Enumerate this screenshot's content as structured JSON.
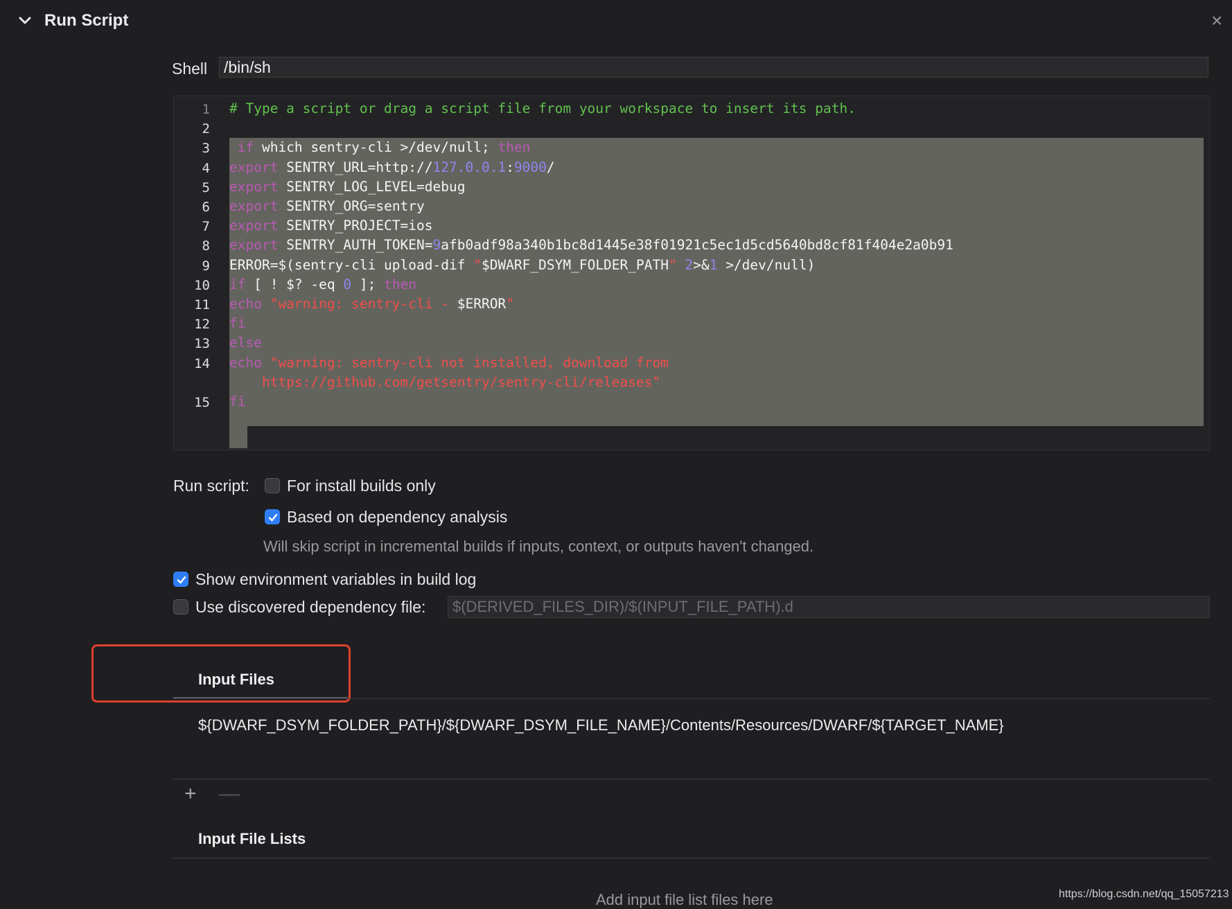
{
  "header": {
    "title": "Run Script",
    "close_glyph": "×",
    "chevron_icon": "chevron-down-icon"
  },
  "shell": {
    "label": "Shell",
    "value": "/bin/sh"
  },
  "editor": {
    "line_numbers": [
      "1",
      "2",
      "3",
      "4",
      "5",
      "6",
      "7",
      "8",
      "9",
      "10",
      "11",
      "12",
      "13",
      "14",
      "15"
    ],
    "lines": [
      [
        {
          "t": "# Type a script or drag a script file from your workspace to insert its path.",
          "c": "comment"
        }
      ],
      [],
      [
        {
          "t": " if",
          "c": "kw"
        },
        {
          "t": " which sentry-cli >/dev/null; ",
          "c": "plain"
        },
        {
          "t": "then",
          "c": "kw"
        }
      ],
      [
        {
          "t": "export",
          "c": "kw"
        },
        {
          "t": " SENTRY_URL=http://",
          "c": "plain"
        },
        {
          "t": "127.0.0.1",
          "c": "num"
        },
        {
          "t": ":",
          "c": "plain"
        },
        {
          "t": "9000",
          "c": "num"
        },
        {
          "t": "/",
          "c": "plain"
        }
      ],
      [
        {
          "t": "export",
          "c": "kw"
        },
        {
          "t": " SENTRY_LOG_LEVEL=debug",
          "c": "plain"
        }
      ],
      [
        {
          "t": "export",
          "c": "kw"
        },
        {
          "t": " SENTRY_ORG=sentry",
          "c": "plain"
        }
      ],
      [
        {
          "t": "export",
          "c": "kw"
        },
        {
          "t": " SENTRY_PROJECT=ios",
          "c": "plain"
        }
      ],
      [
        {
          "t": "export",
          "c": "kw"
        },
        {
          "t": " SENTRY_AUTH_TOKEN=",
          "c": "plain"
        },
        {
          "t": "9",
          "c": "num"
        },
        {
          "t": "afb0adf98a340b1bc8d1445e38f01921c5ec1d5cd5640bd8cf81f404e2a0b91",
          "c": "plain"
        }
      ],
      [
        {
          "t": "ERROR=$(sentry-cli upload-dif ",
          "c": "plain"
        },
        {
          "t": "\"",
          "c": "str"
        },
        {
          "t": "$DWARF_DSYM_FOLDER_PATH",
          "c": "plain"
        },
        {
          "t": "\" ",
          "c": "str"
        },
        {
          "t": "2",
          "c": "num"
        },
        {
          "t": ">&",
          "c": "plain"
        },
        {
          "t": "1",
          "c": "num"
        },
        {
          "t": " >/dev/null)",
          "c": "plain"
        }
      ],
      [
        {
          "t": "if",
          "c": "kw"
        },
        {
          "t": " [ ! $? -eq ",
          "c": "plain"
        },
        {
          "t": "0",
          "c": "num"
        },
        {
          "t": " ]; ",
          "c": "plain"
        },
        {
          "t": "then",
          "c": "kw"
        }
      ],
      [
        {
          "t": "echo",
          "c": "kw"
        },
        {
          "t": " \"warning: sentry-cli - ",
          "c": "str"
        },
        {
          "t": "$ERROR",
          "c": "plain"
        },
        {
          "t": "\"",
          "c": "str"
        }
      ],
      [
        {
          "t": "fi",
          "c": "kw"
        }
      ],
      [
        {
          "t": "else",
          "c": "kw"
        }
      ],
      [
        {
          "t": "echo",
          "c": "kw"
        },
        {
          "t": " \"warning: sentry-cli not installed, download from",
          "c": "str"
        }
      ],
      [
        {
          "t": "    https://github.com/getsentry/sentry-cli/releases\"",
          "c": "str"
        }
      ],
      [
        {
          "t": "fi",
          "c": "kw"
        }
      ]
    ]
  },
  "run_script": {
    "label": "Run script:",
    "install_builds_only": {
      "label": "For install builds only",
      "checked": false
    },
    "dependency_analysis": {
      "label": "Based on dependency analysis",
      "checked": true
    },
    "hint": "Will skip script in incremental builds if inputs, context, or outputs haven't changed."
  },
  "show_env": {
    "label": "Show environment variables in build log",
    "checked": true
  },
  "dep_file": {
    "label": "Use discovered dependency file:",
    "checked": false,
    "placeholder": "$(DERIVED_FILES_DIR)/$(INPUT_FILE_PATH).d"
  },
  "input_files": {
    "title": "Input Files",
    "items": [
      "${DWARF_DSYM_FOLDER_PATH}/${DWARF_DSYM_FILE_NAME}/Contents/Resources/DWARF/${TARGET_NAME}"
    ],
    "add_glyph": "+",
    "remove_glyph": "—"
  },
  "input_file_lists": {
    "title": "Input File Lists",
    "placeholder": "Add input file list files here"
  },
  "watermark": "https://blog.csdn.net/qq_15057213",
  "colors": {
    "accent": "#2f7ef6",
    "highlight": "#e0402f",
    "comment": "#62c04e",
    "keyword": "#b95ab4",
    "number": "#8e86ee",
    "string": "#ee4e4b"
  }
}
